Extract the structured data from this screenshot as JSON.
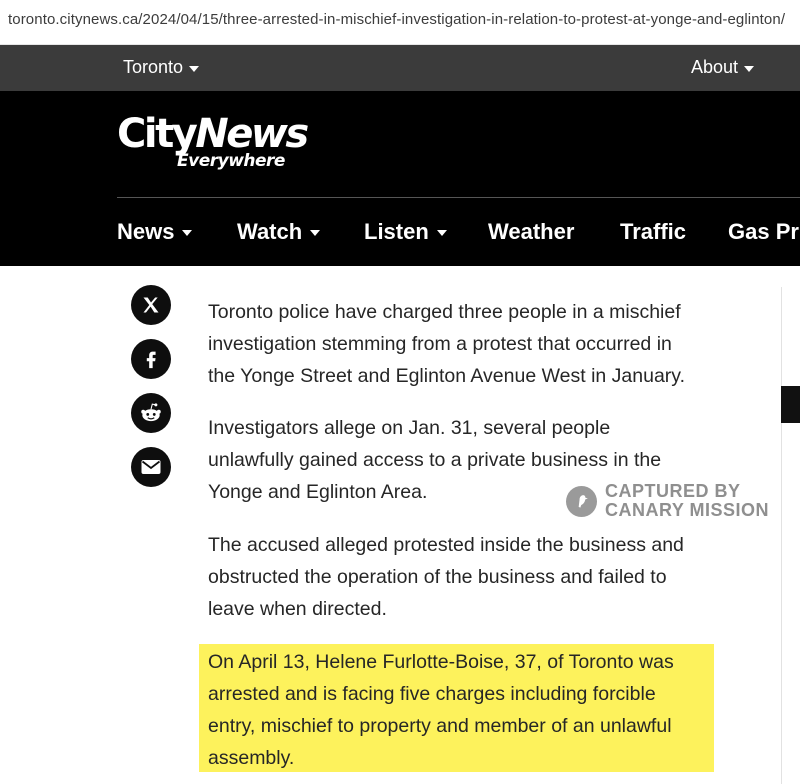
{
  "browser": {
    "url": "toronto.citynews.ca/2024/04/15/three-arrested-in-mischief-investigation-in-relation-to-protest-at-yonge-and-eglinton/"
  },
  "topbar": {
    "region": "Toronto",
    "about": "About"
  },
  "logo": {
    "line1_city": "City",
    "line1_news": "News",
    "line2": "Everywhere"
  },
  "nav": {
    "items": [
      {
        "label": "News",
        "has_dropdown": true
      },
      {
        "label": "Watch",
        "has_dropdown": true
      },
      {
        "label": "Listen",
        "has_dropdown": true
      },
      {
        "label": "Weather",
        "has_dropdown": false
      },
      {
        "label": "Traffic",
        "has_dropdown": false
      },
      {
        "label": "Gas Pri",
        "has_dropdown": false
      }
    ]
  },
  "share": {
    "icons": [
      "x-icon",
      "facebook-icon",
      "reddit-icon",
      "email-icon"
    ]
  },
  "article": {
    "paragraphs": [
      [
        "Toronto police have charged three people in a mischief",
        "investigation stemming from a protest that occurred in",
        "the Yonge Street and Eglinton Avenue West in January."
      ],
      [
        "Investigators allege on Jan. 31, several people",
        "unlawfully gained access to a private business in the",
        "Yonge and Eglinton Area."
      ],
      [
        "The accused alleged protested inside the business and",
        "obstructed the operation of the business and failed to",
        "leave when directed."
      ],
      [
        "On April 13, Helene Furlotte-Boise, 37, of Toronto was",
        "arrested and is facing five charges including forcible",
        "entry, mischief to property and member of an unlawful",
        "assembly."
      ]
    ],
    "highlight_color": "#fdf25c"
  },
  "watermark": {
    "line1": "CAPTURED BY",
    "line2": "CANARY MISSION"
  },
  "colors": {
    "topbar": "#3b3b3b",
    "header": "#000000",
    "text": "#262626"
  }
}
